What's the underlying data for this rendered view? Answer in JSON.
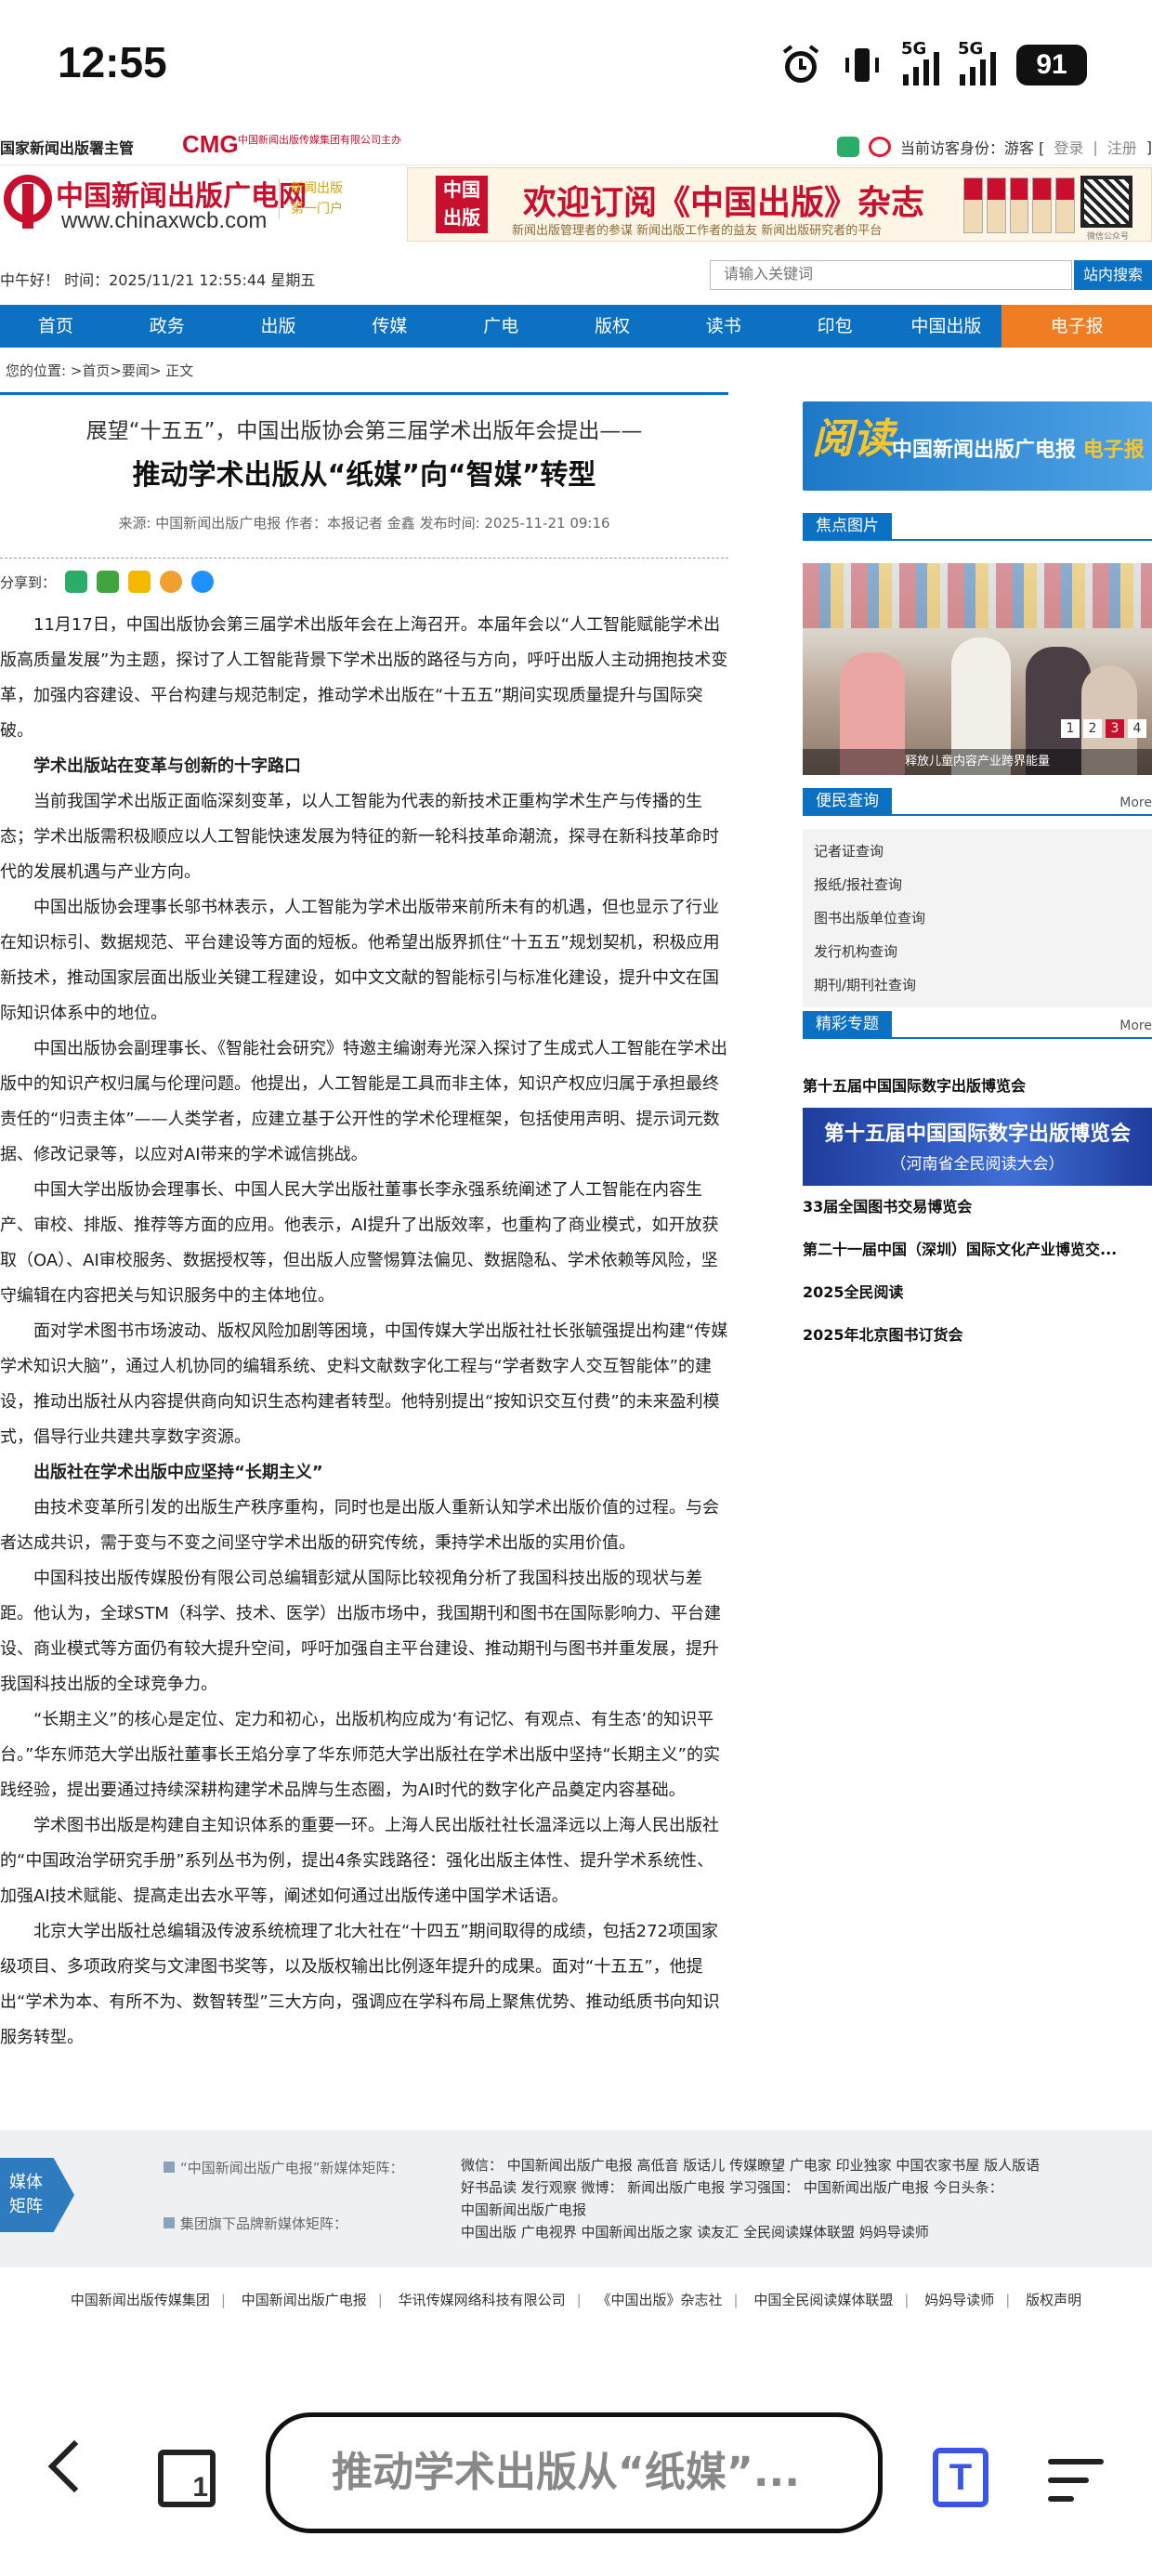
{
  "status_bar": {
    "time": "12:55",
    "signal1_label": "5G",
    "signal2_label": "5G",
    "battery": "91"
  },
  "top_header": {
    "left_text": "国家新闻出版署主管",
    "cmg_logo": "CMG",
    "cmg_text": "中国新闻出版传媒集团有限公司主办",
    "visitor_label": "当前访客身份：游客 [",
    "login": "登录",
    "sep": "|",
    "register": "注册",
    "close": "]"
  },
  "logo": {
    "site_name": "中国新闻出版广电网",
    "url": "www.chinaxwcb.com",
    "tag_line1": "新闻出版",
    "tag_line2": "第一门户"
  },
  "ad": {
    "logo_line1": "中国",
    "logo_line2": "出版",
    "title": "欢迎订阅《中国出版》杂志",
    "subtitle": "新闻出版管理者的参谋  新闻出版工作者的益友  新闻出版研究者的平台",
    "qr_caption": "微信公众号"
  },
  "greeting": {
    "text": "中午好！ 时间：2025/11/21 12:55:44 星期五",
    "search_placeholder": "请输入关键词",
    "search_button": "站内搜索"
  },
  "nav": {
    "items": [
      "首页",
      "政务",
      "出版",
      "传媒",
      "广电",
      "版权",
      "读书",
      "印包",
      "中国出版",
      "电子报"
    ]
  },
  "breadcrumb": "您的位置: >首页>要闻> 正文",
  "article": {
    "kicker": "展望“十五五”，中国出版协会第三届学术出版年会提出——",
    "headline": "推动学术出版从“纸媒”向“智媒”转型",
    "meta": "来源:  中国新闻出版广电报   作者：本报记者 金鑫   发布时间:   2025-11-21 09:16",
    "share_label": "分享到：",
    "paragraphs": [
      {
        "type": "p",
        "text": "11月17日，中国出版协会第三届学术出版年会在上海召开。本届年会以“人工智能赋能学术出版高质量发展”为主题，探讨了人工智能背景下学术出版的路径与方向，呼吁出版人主动拥抱技术变革，加强内容建设、平台构建与规范制定，推动学术出版在“十五五”期间实现质量提升与国际突破。"
      },
      {
        "type": "sub",
        "text": "学术出版站在变革与创新的十字路口"
      },
      {
        "type": "p",
        "text": "当前我国学术出版正面临深刻变革，以人工智能为代表的新技术正重构学术生产与传播的生态；学术出版需积极顺应以人工智能快速发展为特征的新一轮科技革命潮流，探寻在新科技革命时代的发展机遇与产业方向。"
      },
      {
        "type": "p",
        "text": "中国出版协会理事长邬书林表示，人工智能为学术出版带来前所未有的机遇，但也显示了行业在知识标引、数据规范、平台建设等方面的短板。他希望出版界抓住“十五五”规划契机，积极应用新技术，推动国家层面出版业关键工程建设，如中文文献的智能标引与标准化建设，提升中文在国际知识体系中的地位。"
      },
      {
        "type": "p",
        "text": "中国出版协会副理事长、《智能社会研究》特邀主编谢寿光深入探讨了生成式人工智能在学术出版中的知识产权归属与伦理问题。他提出，人工智能是工具而非主体，知识产权应归属于承担最终责任的“归责主体”——人类学者，应建立基于公开性的学术伦理框架，包括使用声明、提示词元数据、修改记录等，以应对AI带来的学术诚信挑战。"
      },
      {
        "type": "p",
        "text": "中国大学出版协会理事长、中国人民大学出版社董事长李永强系统阐述了人工智能在内容生产、审校、排版、推荐等方面的应用。他表示，AI提升了出版效率，也重构了商业模式，如开放获取（OA）、AI审校服务、数据授权等，但出版人应警惕算法偏见、数据隐私、学术依赖等风险，坚守编辑在内容把关与知识服务中的主体地位。"
      },
      {
        "type": "p",
        "text": "面对学术图书市场波动、版权风险加剧等困境，中国传媒大学出版社社长张毓强提出构建“传媒学术知识大脑”，通过人机协同的编辑系统、史料文献数字化工程与“学者数字人交互智能体”的建设，推动出版社从内容提供商向知识生态构建者转型。他特别提出“按知识交互付费”的未来盈利模式，倡导行业共建共享数字资源。"
      },
      {
        "type": "sub",
        "text": "出版社在学术出版中应坚持“长期主义”"
      },
      {
        "type": "p",
        "text": "由技术变革所引发的出版生产秩序重构，同时也是出版人重新认知学术出版价值的过程。与会者达成共识，需于变与不变之间坚守学术出版的研究传统，秉持学术出版的实用价值。"
      },
      {
        "type": "p",
        "text": "中国科技出版传媒股份有限公司总编辑彭斌从国际比较视角分析了我国科技出版的现状与差距。他认为，全球STM（科学、技术、医学）出版市场中，我国期刊和图书在国际影响力、平台建设、商业模式等方面仍有较大提升空间，呼吁加强自主平台建设、推动期刊与图书并重发展，提升我国科技出版的全球竞争力。"
      },
      {
        "type": "p",
        "text": "“长期主义”的核心是定位、定力和初心，出版机构应成为‘有记忆、有观点、有生态’的知识平台。”华东师范大学出版社董事长王焰分享了华东师范大学出版社在学术出版中坚持“长期主义”的实践经验，提出要通过持续深耕构建学术品牌与生态圈，为AI时代的数字化产品奠定内容基础。"
      },
      {
        "type": "p",
        "text": "学术图书出版是构建自主知识体系的重要一环。上海人民出版社社长温泽远以上海人民出版社的“中国政治学研究手册”系列丛书为例，提出4条实践路径：强化出版主体性、提升学术系统性、加强AI技术赋能、提高走出去水平等，阐述如何通过出版传递中国学术话语。"
      },
      {
        "type": "p",
        "text": "北京大学出版社总编辑汲传波系统梳理了北大社在“十四五”期间取得的成绩，包括272项国家级项目、多项政府奖与文津图书奖等，以及版权输出比例逐年提升的成果。面对“十五五”，他提出“学术为本、有所不为、数智转型”三大方向，强调应在学科布局上聚焦优势、推动纸质书向知识服务转型。"
      }
    ]
  },
  "sidebar": {
    "epaper_read": "阅读",
    "epaper_text": "中国新闻出版广电报",
    "epaper_emph": "电子报",
    "focus_title": "焦点图片",
    "focus_caption": "释放儿童内容产业跨界能量",
    "pager": [
      "1",
      "2",
      "3",
      "4"
    ],
    "pager_active": "3",
    "services_title": "便民查询",
    "more": "More",
    "services": [
      "记者证查询",
      "报纸/报社查询",
      "图书出版单位查询",
      "发行机构查询",
      "期刊/期刊社查询"
    ],
    "topics_title": "精彩专题",
    "topic_first": "第十五届中国国际数字出版博览会",
    "banner_line1": "第十五届中国国际数字出版博览会",
    "banner_line2": "（河南省全民阅读大会）",
    "topics_rest": [
      "33届全国图书交易博览会",
      "第二十一届中国（深圳）国际文化产业博览交...",
      "2025全民阅读",
      "2025年北京图书订货会"
    ]
  },
  "media_matrix": {
    "badge_line1": "媒体",
    "badge_line2": "矩阵",
    "label1": "“中国新闻出版广电报”新媒体矩阵：",
    "label2": "集团旗下品牌新媒体矩阵：",
    "links_line1": "微信：  中国新闻出版广电报  高低音  版话儿  传媒瞭望  广电家  印业独家  中国农家书屋  版人版语",
    "links_line2": "好书品读  发行观察   微博：  新闻出版广电报   学习强国：    中国新闻出版广电报  今日头条：",
    "links_line3": "中国新闻出版广电报",
    "links_line4": "中国出版  广电视界  中国新闻出版之家  读友汇  全民阅读媒体联盟  妈妈导读师"
  },
  "footer": {
    "links": [
      "中国新闻出版传媒集团",
      "中国新闻出版广电报",
      "华讯传媒网络科技有限公司",
      "《中国出版》杂志社",
      "中国全民阅读媒体联盟",
      "妈妈导读师",
      "版权声明"
    ]
  },
  "browser": {
    "url_title": "推动学术出版从“纸媒”...",
    "tab_count": "1",
    "reader_glyph": "T"
  }
}
